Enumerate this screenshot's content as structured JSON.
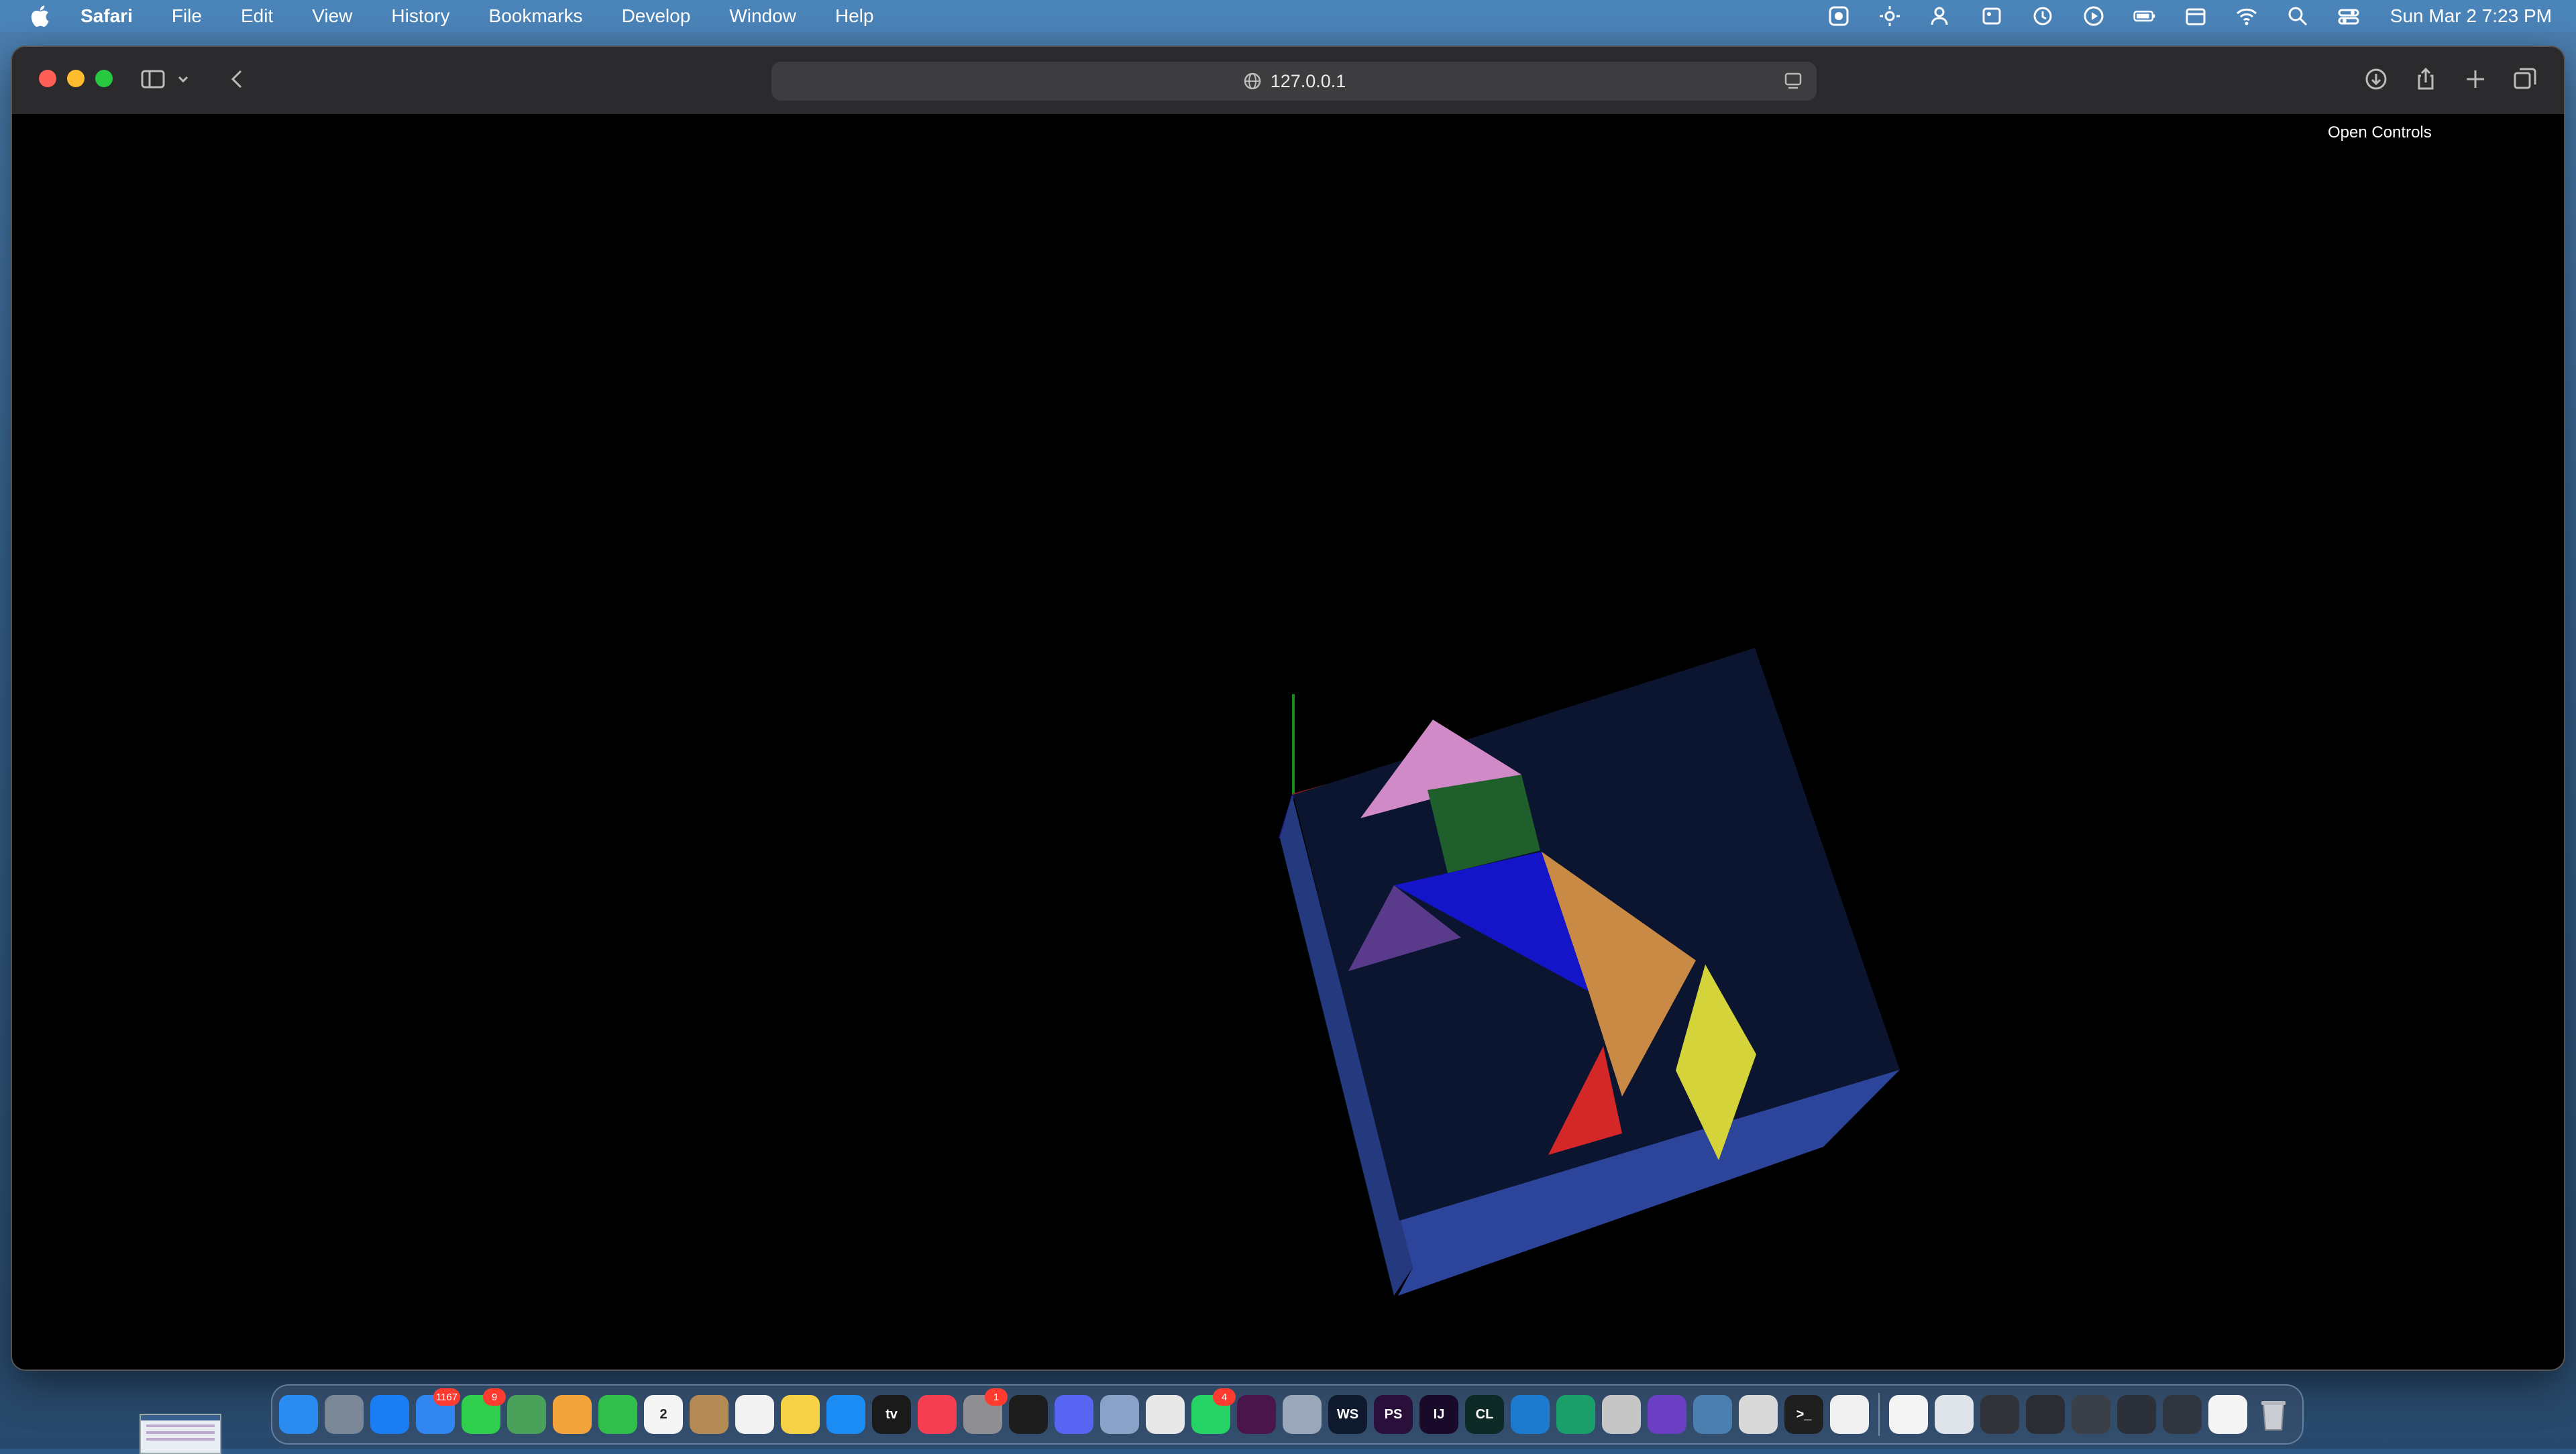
{
  "menubar": {
    "app_name": "Safari",
    "items": [
      "File",
      "Edit",
      "View",
      "History",
      "Bookmarks",
      "Develop",
      "Window",
      "Help"
    ],
    "clock": "Sun Mar 2  7:23 PM"
  },
  "browser": {
    "url": "127.0.0.1"
  },
  "page": {
    "open_controls": "Open Controls"
  },
  "dock": {
    "apps": [
      {
        "name": "finder",
        "color": "#2a8cf0",
        "label": ""
      },
      {
        "name": "launchpad",
        "color": "#7b8796",
        "label": ""
      },
      {
        "name": "safari",
        "color": "#1b7df2",
        "label": ""
      },
      {
        "name": "mail",
        "color": "#2f86f0",
        "label": "",
        "badge": "1167"
      },
      {
        "name": "messages",
        "color": "#2fcf4d",
        "label": "",
        "badge": "9"
      },
      {
        "name": "maps",
        "color": "#4aa15a",
        "label": ""
      },
      {
        "name": "photos",
        "color": "#f2a33a",
        "label": ""
      },
      {
        "name": "facetime",
        "color": "#2fbf4a",
        "label": ""
      },
      {
        "name": "calendar",
        "color": "#f4f4f4",
        "label": "2"
      },
      {
        "name": "contacts",
        "color": "#b58a55",
        "label": ""
      },
      {
        "name": "reminders",
        "color": "#f2f2f2",
        "label": ""
      },
      {
        "name": "notes",
        "color": "#f5d245",
        "label": ""
      },
      {
        "name": "app-store",
        "color": "#1c8cf5",
        "label": ""
      },
      {
        "name": "apple-tv",
        "color": "#1a1a1a",
        "label": "tv"
      },
      {
        "name": "music",
        "color": "#f63e53",
        "label": ""
      },
      {
        "name": "system-settings",
        "color": "#8e8e93",
        "label": "",
        "badge": "1"
      },
      {
        "name": "activity-ring",
        "color": "#1d1d1d",
        "label": ""
      },
      {
        "name": "discord",
        "color": "#5865f2",
        "label": ""
      },
      {
        "name": "preview",
        "color": "#8aa2c8",
        "label": ""
      },
      {
        "name": "chrome",
        "color": "#e8e8e8",
        "label": ""
      },
      {
        "name": "whatsapp",
        "color": "#25d366",
        "label": "",
        "badge": "4"
      },
      {
        "name": "slack",
        "color": "#4a154b",
        "label": ""
      },
      {
        "name": "virtualbox",
        "color": "#9aa7b8",
        "label": ""
      },
      {
        "name": "webstorm",
        "color": "#0f1a2e",
        "label": "WS"
      },
      {
        "name": "phpstorm",
        "color": "#2a0f3a",
        "label": "PS"
      },
      {
        "name": "intellij",
        "color": "#1a0a2a",
        "label": "IJ"
      },
      {
        "name": "clion",
        "color": "#0d2a26",
        "label": "CL"
      },
      {
        "name": "vscode",
        "color": "#1e7acf",
        "label": ""
      },
      {
        "name": "vscode-insiders",
        "color": "#1a9e6a",
        "label": ""
      },
      {
        "name": "xcode-instruments",
        "color": "#c6c6c6",
        "label": ""
      },
      {
        "name": "obsidian",
        "color": "#6a3fc4",
        "label": ""
      },
      {
        "name": "tailscale",
        "color": "#4a7fb0",
        "label": ""
      },
      {
        "name": "script-editor",
        "color": "#d9d9d9",
        "label": ""
      },
      {
        "name": "terminal",
        "color": "#1f1f1f",
        "label": ">_"
      },
      {
        "name": "textedit",
        "color": "#f0f0f0",
        "label": ""
      }
    ],
    "recents": [
      {
        "name": "google-drive",
        "color": "#f4f4f4"
      },
      {
        "name": "window-1",
        "color": "#dfe4ea"
      },
      {
        "name": "window-2",
        "color": "#30343a"
      },
      {
        "name": "window-3",
        "color": "#2a2e34"
      },
      {
        "name": "window-4",
        "color": "#3b4048"
      },
      {
        "name": "window-5",
        "color": "#2c3038"
      },
      {
        "name": "window-6",
        "color": "#303640"
      },
      {
        "name": "window-7",
        "color": "#f4f4f4"
      }
    ]
  },
  "colors": {
    "scene_bg": "#000000",
    "box_top": "#0b1530",
    "box_side_left": "#25397f",
    "box_side_front": "#2c449a",
    "pink": "#d08ac8",
    "green": "#1e5f2c",
    "blue": "#1414c8",
    "purple": "#5a3a8a",
    "orange": "#c88a45",
    "yellow": "#d4d43a",
    "red": "#d42828"
  }
}
